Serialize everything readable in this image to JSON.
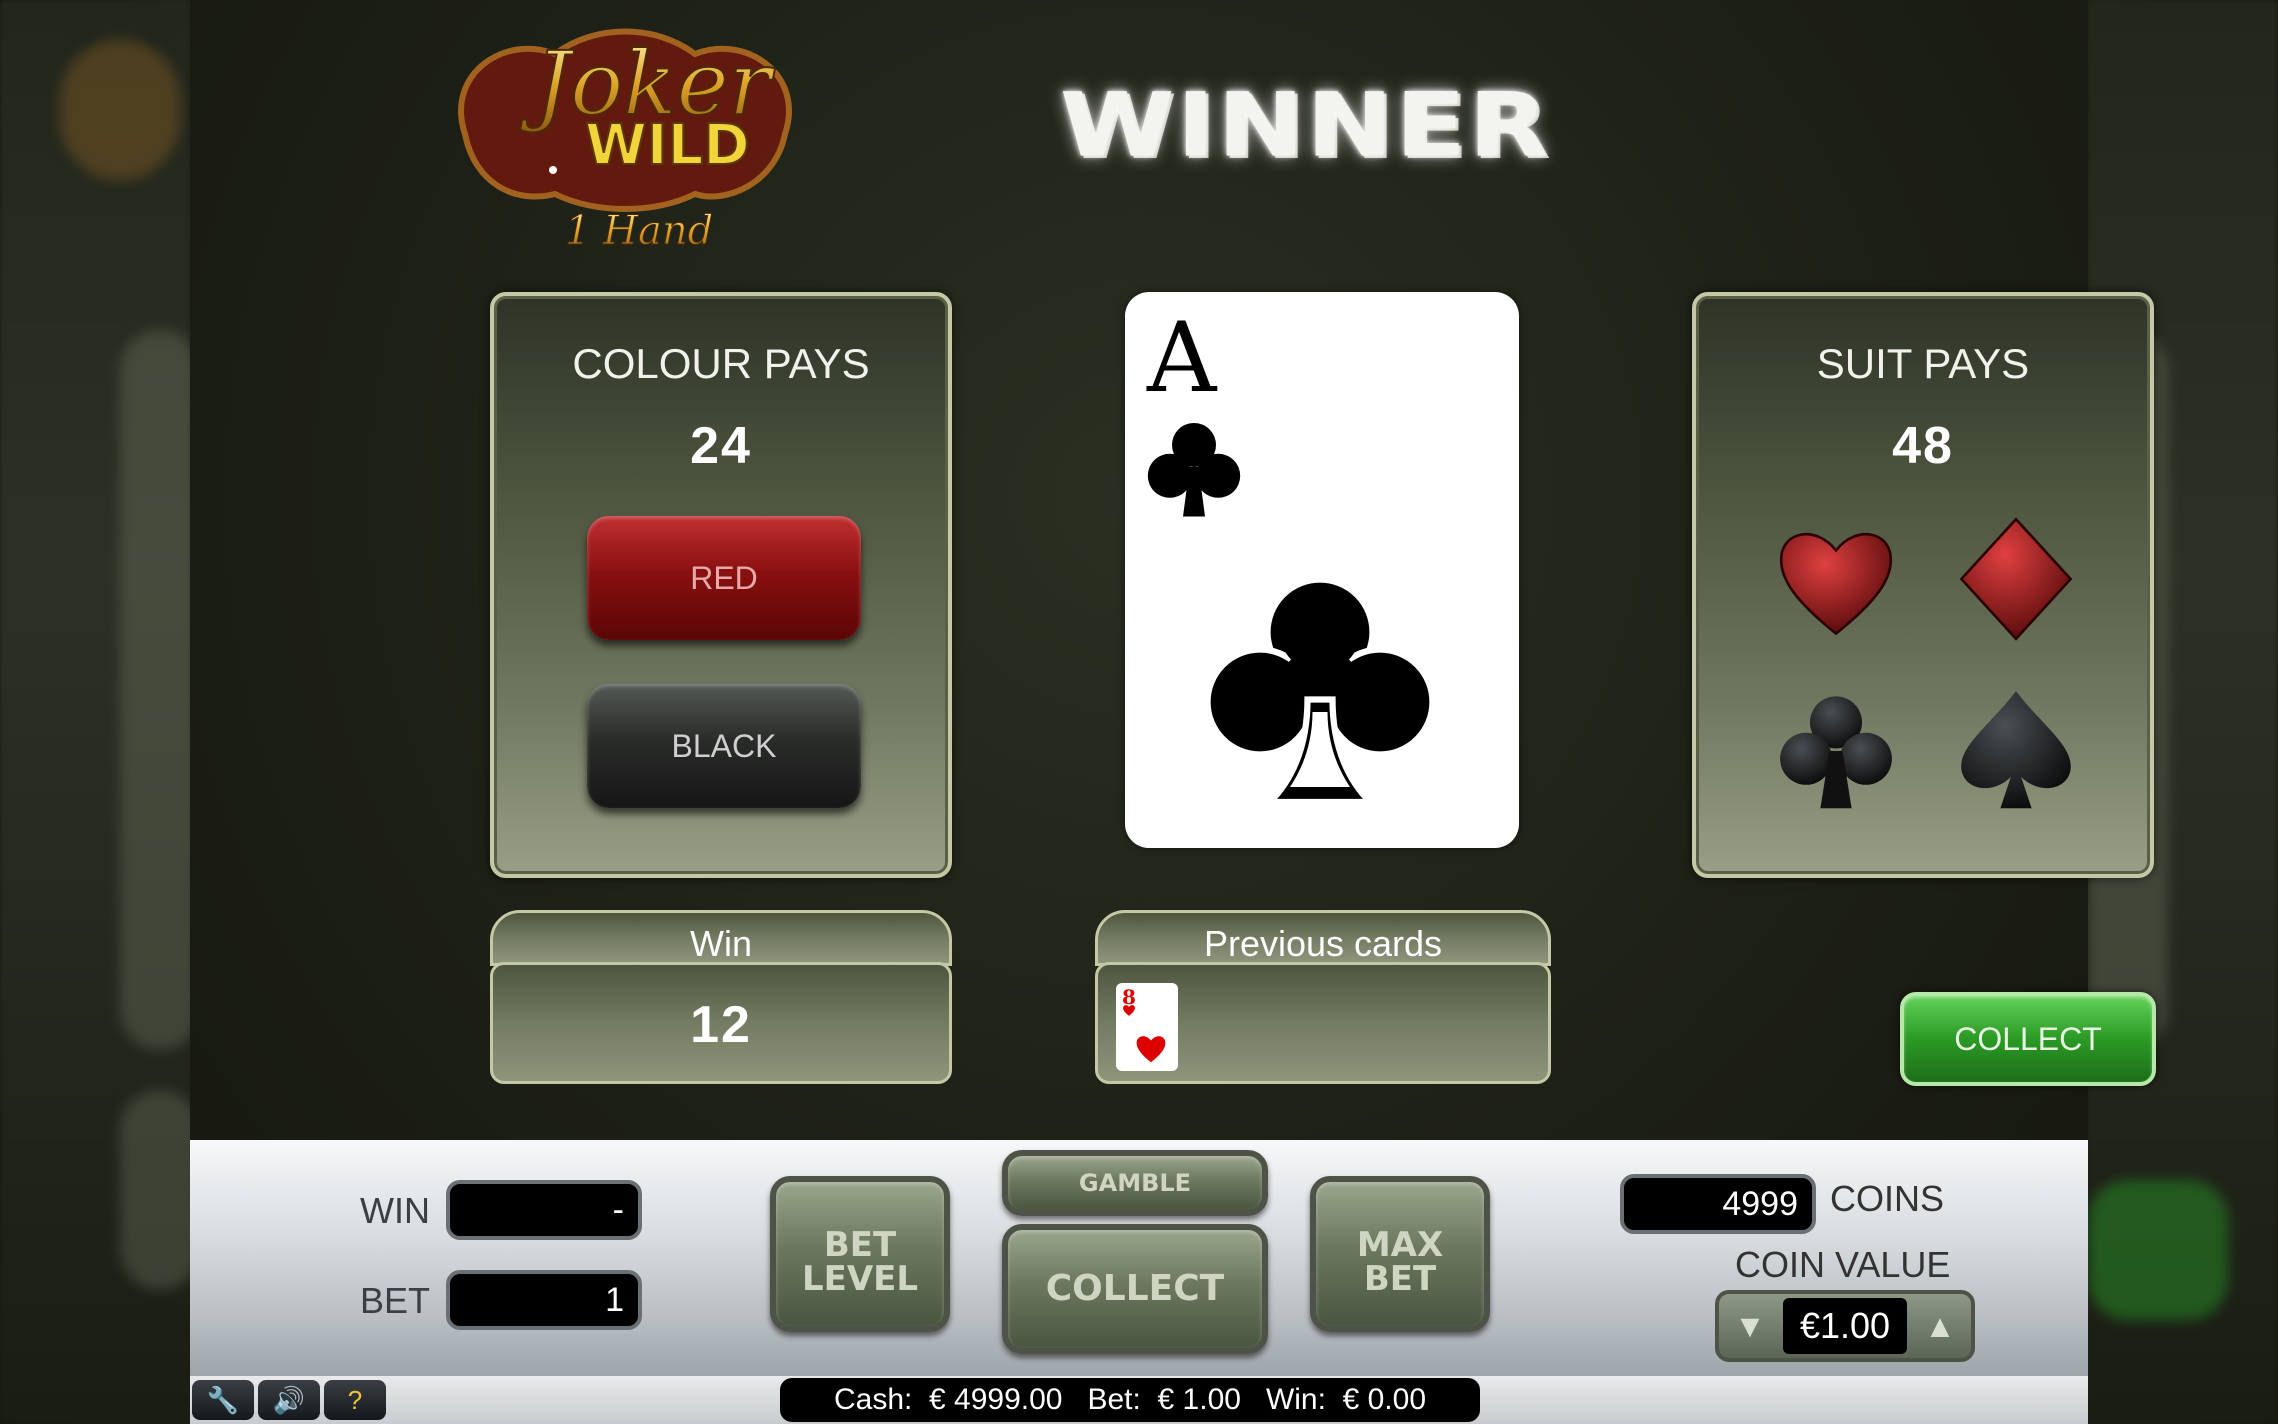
{
  "logo": {
    "line1": "Joker",
    "line2": "WILD",
    "line3": "1 Hand"
  },
  "header": {
    "banner": "WINNER"
  },
  "colour_panel": {
    "title": "COLOUR PAYS",
    "value": "24",
    "red_label": "RED",
    "black_label": "BLACK"
  },
  "suit_panel": {
    "title": "SUIT PAYS",
    "value": "48",
    "suits": [
      "heart-icon",
      "diamond-icon",
      "club-icon",
      "spade-icon"
    ]
  },
  "card": {
    "rank": "A",
    "suit": "club-icon"
  },
  "win_box": {
    "label": "Win",
    "value": "12"
  },
  "previous_cards": {
    "label": "Previous cards",
    "cards": [
      {
        "rank": "8",
        "suit": "heart-icon"
      }
    ]
  },
  "collect_button": {
    "label": "COLLECT"
  },
  "control_bar": {
    "win_label": "WIN",
    "win_value": "-",
    "bet_label": "BET",
    "bet_value": "1",
    "bet_level_line1": "BET",
    "bet_level_line2": "LEVEL",
    "gamble_label": "GAMBLE",
    "collect_label": "COLLECT",
    "max_bet_line1": "MAX",
    "max_bet_line2": "BET",
    "coins_value": "4999",
    "coins_label": "COINS",
    "coin_value_label": "COIN VALUE",
    "coin_value": "€1.00"
  },
  "status_bar": {
    "tools": [
      "wrench-icon",
      "speaker-icon",
      "help-icon"
    ],
    "text": "Cash:  € 4999.00   Bet:  € 1.00   Win:  € 0.00"
  },
  "colors": {
    "red_button": "#8a1010",
    "black_button": "#2a2c2a",
    "collect_green": "#2b9a25",
    "panel_border": "#c5c8a4"
  }
}
